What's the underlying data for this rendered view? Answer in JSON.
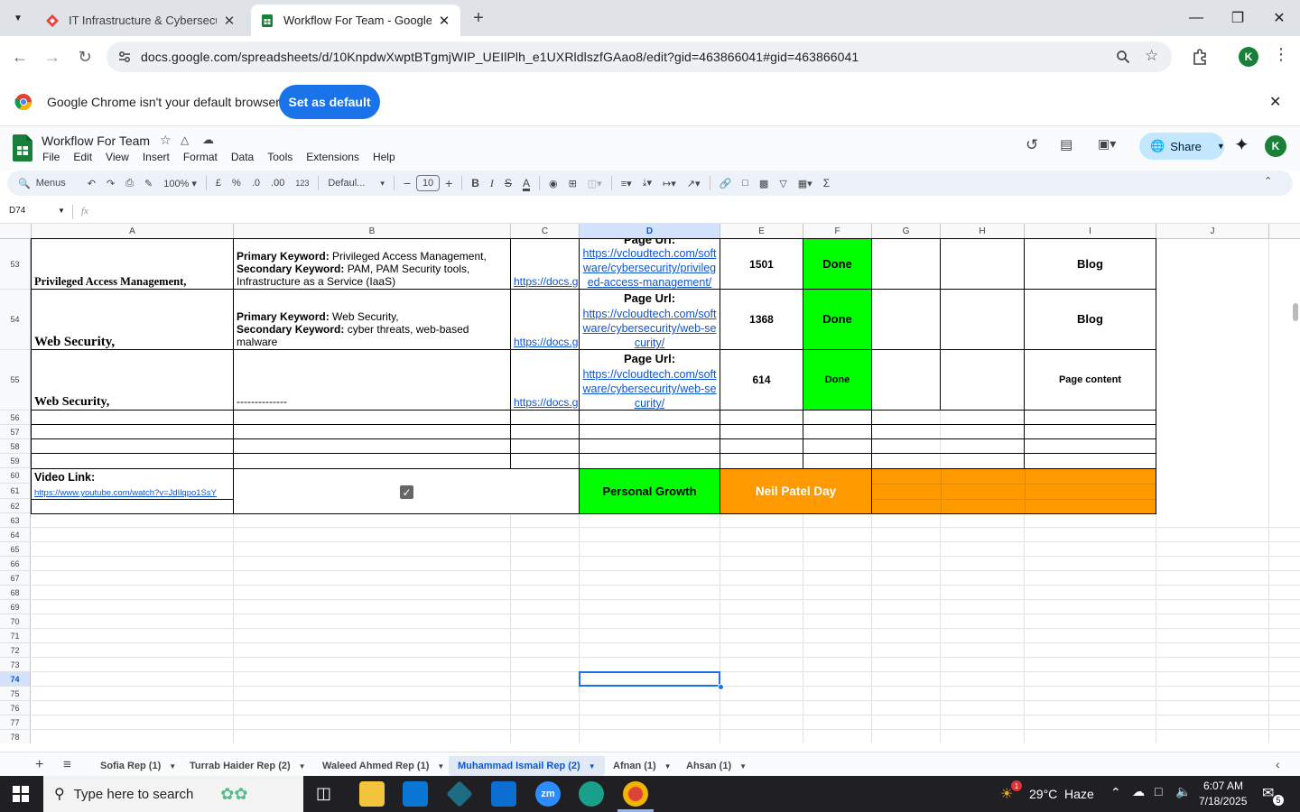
{
  "browser": {
    "tabs": [
      {
        "title": "IT Infrastructure & Cybersecurit",
        "active": false
      },
      {
        "title": "Workflow For Team - Google Sh",
        "active": true
      }
    ],
    "url": "docs.google.com/spreadsheets/d/10KnpdwXwptBTgmjWIP_UEIlPlh_e1UXRldlszfGAao8/edit?gid=463866041#gid=463866041",
    "profile_initial": "K"
  },
  "infobar": {
    "message": "Google Chrome isn't your default browser",
    "button": "Set as default"
  },
  "sheets": {
    "doc_title": "Workflow For Team",
    "menus": [
      "File",
      "Edit",
      "View",
      "Insert",
      "Format",
      "Data",
      "Tools",
      "Extensions",
      "Help"
    ],
    "share_label": "Share",
    "profile_initial": "K",
    "toolbar": {
      "menus_label": "Menus",
      "zoom": "100%",
      "currency": "£",
      "percent": "%",
      "dec_less": ".0",
      "dec_more": ".00",
      "number_format": "123",
      "font": "Defaul...",
      "font_size": "10",
      "bold": "B",
      "italic": "I",
      "strike": "S",
      "text_color": "A",
      "sum": "Σ"
    },
    "name_box": "D74",
    "fx": "fx",
    "columns": [
      "A",
      "B",
      "C",
      "D",
      "E",
      "F",
      "G",
      "H",
      "I",
      "J"
    ],
    "rows": [
      "53",
      "54",
      "55",
      "56",
      "57",
      "58",
      "59",
      "60",
      "61",
      "62",
      "63",
      "64",
      "65",
      "66",
      "67",
      "68",
      "69",
      "70",
      "71",
      "72",
      "73",
      "74",
      "75",
      "76",
      "77",
      "78"
    ],
    "selected_cell": "D74",
    "data": {
      "r53": {
        "a": "Privileged Access Management,",
        "b_primary_label": "Primary Keyword:",
        "b_primary": " Privileged Access Management,",
        "b_secondary_label": "Secondary Keyword:",
        "b_secondary": " PAM, PAM Security tools, Infrastructure as a Service (IaaS)",
        "c": "https://docs.g",
        "d_label": "Page Url:",
        "d_link": "https://vcloudtech.com/software/cybersecurity/privileged-access-management/",
        "e": "1501",
        "f": "Done",
        "i": "Blog"
      },
      "r54": {
        "a": "Web Security,",
        "b_primary_label": "Primary Keyword:",
        "b_primary": " Web Security,",
        "b_secondary_label": "Secondary Keyword:",
        "b_secondary": " cyber threats, web-based malware",
        "c": "https://docs.g",
        "d_label": "Page Url:",
        "d_link": "https://vcloudtech.com/software/cybersecurity/web-security/",
        "e": "1368",
        "f": "Done",
        "i": "Blog"
      },
      "r55": {
        "a": "Web Security,",
        "b": "--------------",
        "c": "https://docs.g",
        "d_label": "Page Url:",
        "d_link": "https://vcloudtech.com/software/cybersecurity/web-security/",
        "e": "614",
        "f": "Done",
        "i": "Page content"
      },
      "video_label": "Video Link:",
      "video_link": "https://www.youtube.com/watch?v=JdIlqpo1SsY",
      "personal_growth": "Personal Growth",
      "neil_patel": "Neil Patel Day"
    },
    "sheet_tabs": [
      {
        "label": "Sofia Rep (1)",
        "active": false
      },
      {
        "label": "Turrab Haider Rep (2)",
        "active": false
      },
      {
        "label": "Waleed Ahmed Rep (1)",
        "active": false
      },
      {
        "label": "Muhammad Ismail Rep (2)",
        "active": true
      },
      {
        "label": "Afnan (1)",
        "active": false
      },
      {
        "label": "Ahsan (1)",
        "active": false
      }
    ]
  },
  "taskbar": {
    "search_placeholder": "Type here to search",
    "weather": "29°C  Haze",
    "weather_badge": "1",
    "time": "6:07 AM",
    "date": "7/18/2025",
    "notification_count": "5"
  },
  "colors": {
    "done_green": "#00ff00",
    "orange": "#ff9900",
    "chrome_blue": "#1a73e8",
    "sheets_green": "#188038",
    "link": "#1155cc"
  }
}
